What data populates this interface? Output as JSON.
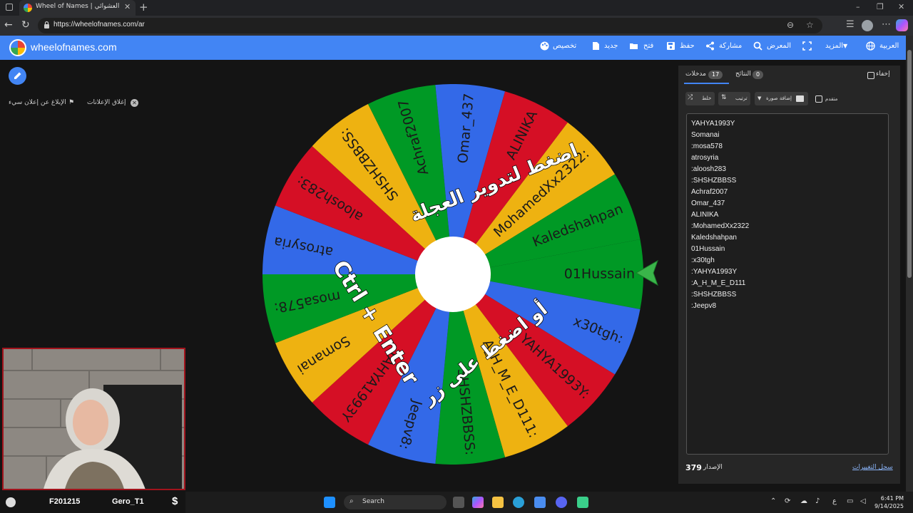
{
  "browser": {
    "tab_title": "Wheel of Names | الاسم العشوائي",
    "url": "https://wheelofnames.com/ar"
  },
  "site": {
    "name": "wheelofnames.com",
    "menu": {
      "customize": "تخصيص",
      "new": "جديد",
      "open": "فتح",
      "save": "حفظ",
      "share": "مشاركة",
      "gallery": "المعرض",
      "more": "المزيد",
      "language": "العربية"
    }
  },
  "ads": {
    "close_ads": "إغلاق الإعلانات",
    "report_ad": "الإبلاغ عن إعلان سيء"
  },
  "wheel": {
    "overlay_top": "اضغط لتدوير العجلة",
    "overlay_ctrl": "Ctrl + Enter",
    "overlay_bottom": "أو اضغط على زر",
    "colors": [
      "#3369e8",
      "#d50f25",
      "#eeb211",
      "#009925"
    ],
    "segments": [
      "01Hussain",
      "x30tgh:",
      "YAHYA1993Y:",
      "A_H_M_E_D111:",
      "SHSHZBBSS:",
      "Jeepv8:",
      "YAHYA1993Y",
      "Somanai",
      "mosa578:",
      "atrosyria",
      "aloosh283:",
      "SHSHZBBSS:",
      "Achraf2007",
      "Omar_437",
      "ALINIKA",
      "MohamedXx2322:",
      "Kaledshahpan"
    ]
  },
  "panel": {
    "tab_entries": "مدخلات",
    "entries_count": "17",
    "tab_results": "النتائج",
    "results_count": "0",
    "hide": "إخفاء",
    "shuffle": "خلط",
    "sort": "ترتيب",
    "add_image": "إضافة صورة",
    "advanced": "متقدم",
    "entries": [
      "YAHYA1993Y",
      "Somanai",
      ":mosa578",
      "atrosyria",
      ":aloosh283",
      ":SHSHZBBSS",
      "Achraf2007",
      "Omar_437",
      "ALINIKA",
      ":MohamedXx2322",
      "Kaledshahpan",
      "01Hussain",
      ":x30tgh",
      ":YAHYA1993Y",
      ":A_H_M_E_D111",
      ":SHSHZBBSS",
      ":Jeepv8"
    ],
    "version_label": "الإصدار",
    "version": "379",
    "changelog": "سجل التغييرات"
  },
  "stream": {
    "code": "F201215",
    "name": "Gero_T1",
    "dollar": "$"
  },
  "taskbar": {
    "search": "Search",
    "lang": "ع",
    "time": "6:41 PM",
    "date": "9/14/2025"
  }
}
